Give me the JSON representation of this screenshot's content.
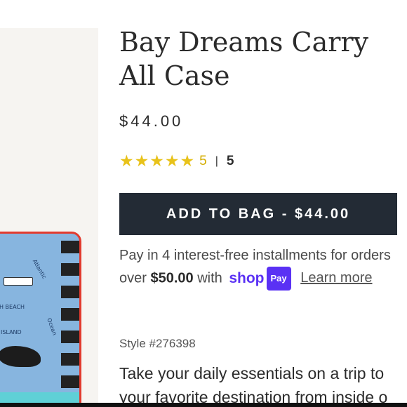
{
  "product": {
    "title": "Bay Dreams Carry All Case",
    "price": "$44.00",
    "rating": {
      "stars": 5,
      "value": "5",
      "separator": "|",
      "count": "5",
      "star_glyph": "★"
    },
    "add_to_bag_label": "ADD TO BAG - $44.00",
    "installments": {
      "prefix": "Pay in 4 interest-free installments for orders",
      "over": "over",
      "amount": "$50.00",
      "with": "with",
      "shop_logo": "shop",
      "pay_badge": "Pay",
      "learn_more": "Learn more"
    },
    "style": "Style #276398",
    "description_line1": "Take your daily essentials on a trip to",
    "description_line2": "your favorite destination from inside o"
  },
  "image_text": {
    "sea": "Atlantic",
    "ocean": "Ocean",
    "beach": "H BEACH",
    "island": "ISLAND"
  },
  "colors": {
    "button_bg": "#232b35",
    "star": "#e8c21a",
    "shop_pay": "#5a31f4"
  }
}
